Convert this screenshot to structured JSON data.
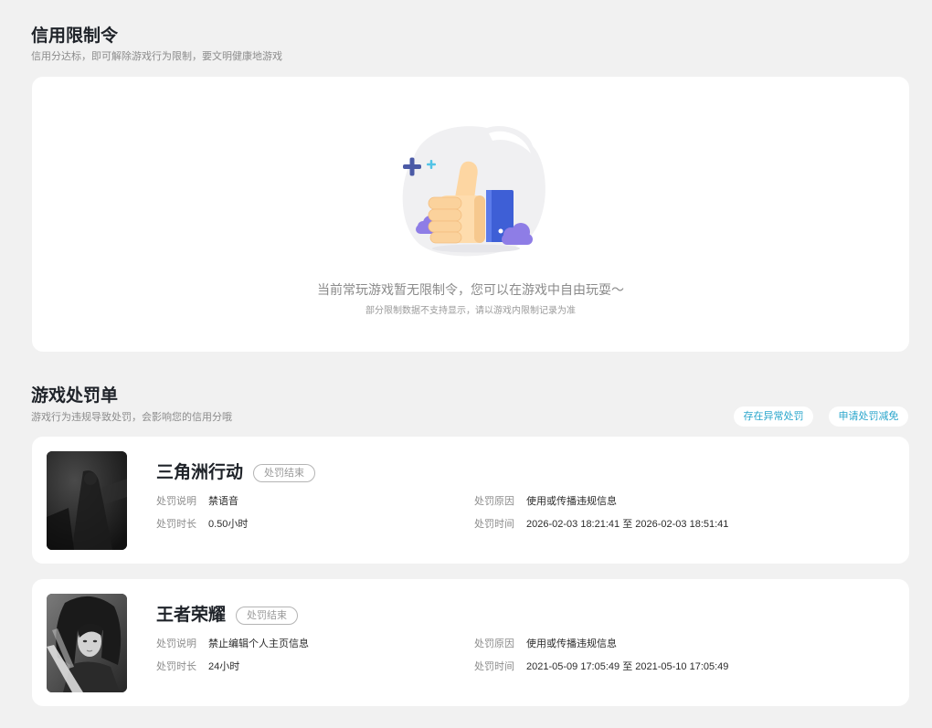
{
  "restriction": {
    "title": "信用限制令",
    "subtitle": "信用分达标，即可解除游戏行为限制，要文明健康地游戏",
    "empty_icon": "thumbs-up-illustration",
    "empty_text": "当前常玩游戏暂无限制令，您可以在游戏中自由玩耍～",
    "empty_note": "部分限制数据不支持显示，请以游戏内限制记录为准"
  },
  "penalties": {
    "title": "游戏处罚单",
    "subtitle": "游戏行为违规导致处罚，会影响您的信用分哦",
    "actions": {
      "report_abnormal": "存在异常处罚",
      "apply_reduction": "申请处罚减免"
    },
    "labels": {
      "description": "处罚说明",
      "reason": "处罚原因",
      "duration": "处罚时长",
      "time": "处罚时间"
    },
    "items": [
      {
        "game": "三角洲行动",
        "status": "处罚结束",
        "description": "禁语音",
        "reason": "使用或传播违规信息",
        "duration": "0.50小时",
        "time": "2026-02-03 18:21:41 至 2026-02-03 18:51:41",
        "cover": "game-cover-image"
      },
      {
        "game": "王者荣耀",
        "status": "处罚结束",
        "description": "禁止编辑个人主页信息",
        "reason": "使用或传播违规信息",
        "duration": "24小时",
        "time": "2021-05-09 17:05:49 至 2021-05-10 17:05:49",
        "cover": "game-cover-image"
      }
    ]
  },
  "colors": {
    "page_bg": "#f1f1f1",
    "card_bg": "#ffffff",
    "accent": "#2aa6cc",
    "status_border": "#b4b4b4"
  }
}
